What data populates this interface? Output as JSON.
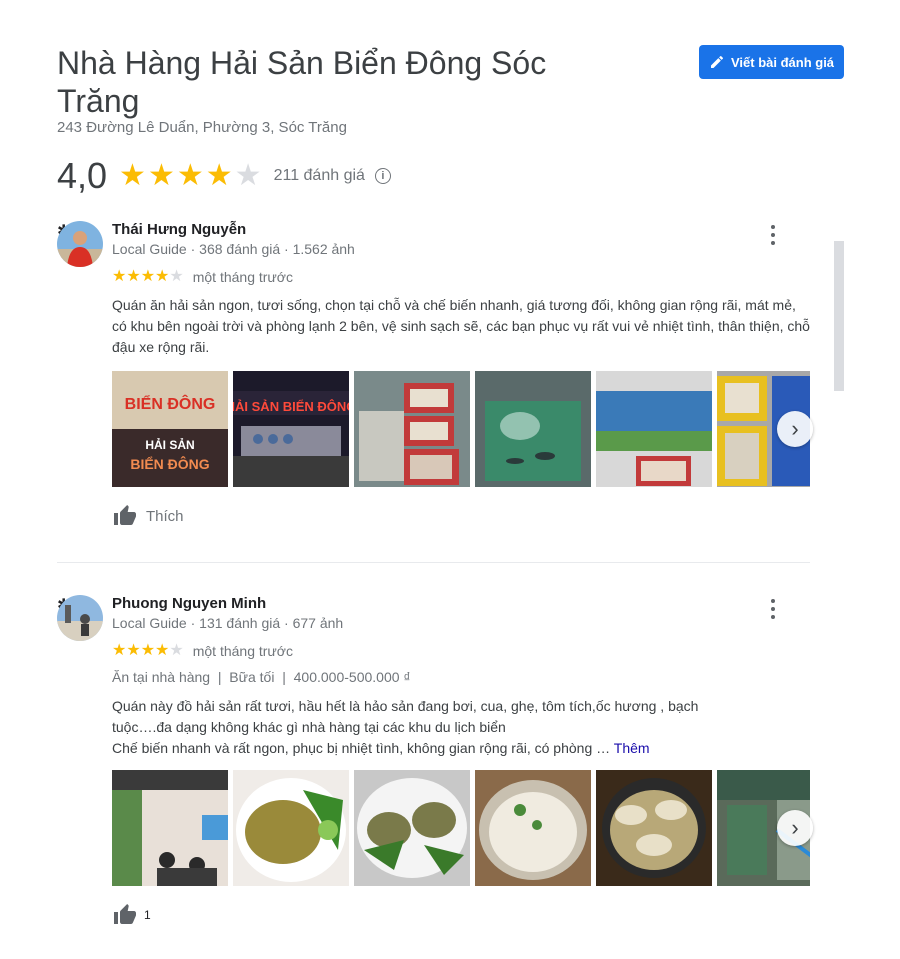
{
  "place": {
    "title": "Nhà Hàng Hải Sản Biển Đông Sóc Trăng",
    "address": "243 Đường Lê Duẩn, Phường 3, Sóc Trăng",
    "rating": "4,0",
    "rating_value": 4,
    "review_count": "211 đánh giá",
    "write_review_label": "Viết bài đánh giá",
    "accent_color": "#1a73e8",
    "star_color": "#fbbc04"
  },
  "reviews": [
    {
      "name": "Thái Hưng Nguyễn",
      "meta": "Local Guide · 368 đánh giá · 1.562 ảnh",
      "rating_value": 4,
      "when": "một tháng trước",
      "text": "Quán ăn hải sản ngon, tươi sống, chọn tại chỗ và chế biến nhanh, giá tương đối, không gian rộng rãi, mát mẻ, có khu bên ngoài trời và phòng lạnh 2 bên, vệ sinh sạch sẽ, các bạn phục vụ rất vui vẻ nhiệt tình, thân thiện, chỗ đậu xe rộng rãi.",
      "photo_signs": [
        "BIỂN ĐÔNG",
        "HẢI SẢN",
        "BIỂN ĐÔNG",
        "HẢI SẢN BIỂN ĐÔNG"
      ],
      "like_label": "Thích"
    },
    {
      "name": "Phuong Nguyen Minh",
      "meta": "Local Guide · 131 đánh giá · 677 ảnh",
      "rating_value": 4,
      "when": "một tháng trước",
      "tags": "Ăn tại nhà hàng  |  Bữa tối  |  400.000-500.000 ₫",
      "text_line1": "Quán này đồ hải sản rất tươi, hầu hết là hảo sản đang bơi, cua, ghẹ, tôm tích,ốc hương , bạch",
      "text_line2": "tuộc….đa dạng không khác gì nhà hàng tại các khu du lịch biển",
      "text_line3": "Chế biến nhanh và rất ngon, phục bị nhiệt tình, không gian rộng rãi, có phòng … ",
      "more_label": "Thêm",
      "like_count": "1"
    }
  ]
}
